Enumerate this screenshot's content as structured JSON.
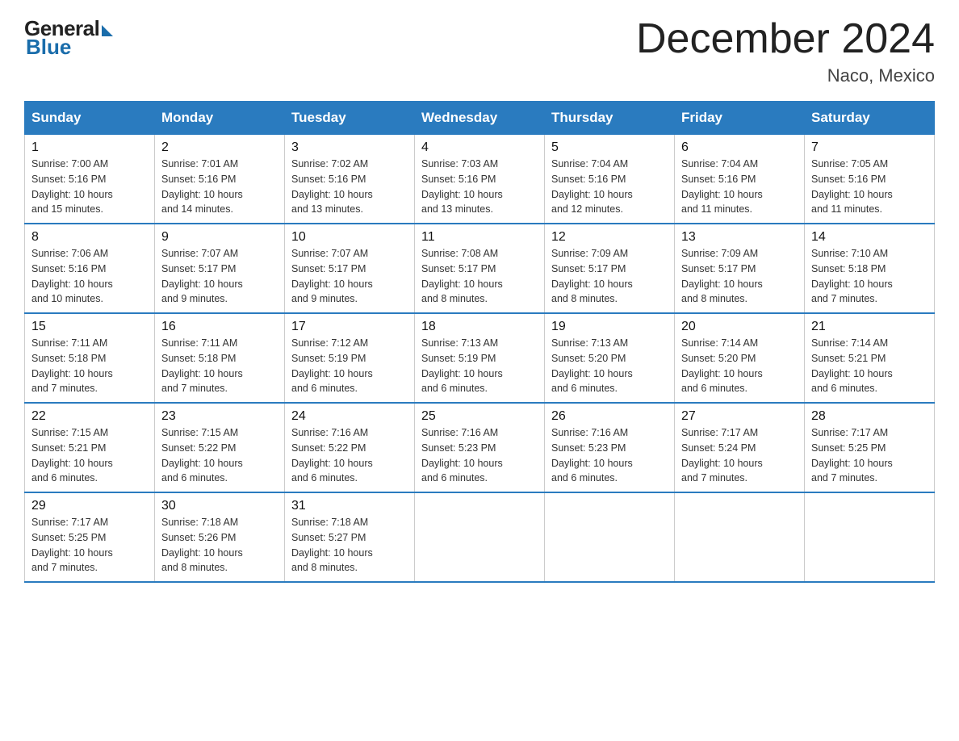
{
  "header": {
    "logo_general": "General",
    "logo_blue": "Blue",
    "month_title": "December 2024",
    "location": "Naco, Mexico"
  },
  "weekdays": [
    "Sunday",
    "Monday",
    "Tuesday",
    "Wednesday",
    "Thursday",
    "Friday",
    "Saturday"
  ],
  "weeks": [
    [
      {
        "day": "1",
        "sunrise": "7:00 AM",
        "sunset": "5:16 PM",
        "daylight": "10 hours and 15 minutes."
      },
      {
        "day": "2",
        "sunrise": "7:01 AM",
        "sunset": "5:16 PM",
        "daylight": "10 hours and 14 minutes."
      },
      {
        "day": "3",
        "sunrise": "7:02 AM",
        "sunset": "5:16 PM",
        "daylight": "10 hours and 13 minutes."
      },
      {
        "day": "4",
        "sunrise": "7:03 AM",
        "sunset": "5:16 PM",
        "daylight": "10 hours and 13 minutes."
      },
      {
        "day": "5",
        "sunrise": "7:04 AM",
        "sunset": "5:16 PM",
        "daylight": "10 hours and 12 minutes."
      },
      {
        "day": "6",
        "sunrise": "7:04 AM",
        "sunset": "5:16 PM",
        "daylight": "10 hours and 11 minutes."
      },
      {
        "day": "7",
        "sunrise": "7:05 AM",
        "sunset": "5:16 PM",
        "daylight": "10 hours and 11 minutes."
      }
    ],
    [
      {
        "day": "8",
        "sunrise": "7:06 AM",
        "sunset": "5:16 PM",
        "daylight": "10 hours and 10 minutes."
      },
      {
        "day": "9",
        "sunrise": "7:07 AM",
        "sunset": "5:17 PM",
        "daylight": "10 hours and 9 minutes."
      },
      {
        "day": "10",
        "sunrise": "7:07 AM",
        "sunset": "5:17 PM",
        "daylight": "10 hours and 9 minutes."
      },
      {
        "day": "11",
        "sunrise": "7:08 AM",
        "sunset": "5:17 PM",
        "daylight": "10 hours and 8 minutes."
      },
      {
        "day": "12",
        "sunrise": "7:09 AM",
        "sunset": "5:17 PM",
        "daylight": "10 hours and 8 minutes."
      },
      {
        "day": "13",
        "sunrise": "7:09 AM",
        "sunset": "5:17 PM",
        "daylight": "10 hours and 8 minutes."
      },
      {
        "day": "14",
        "sunrise": "7:10 AM",
        "sunset": "5:18 PM",
        "daylight": "10 hours and 7 minutes."
      }
    ],
    [
      {
        "day": "15",
        "sunrise": "7:11 AM",
        "sunset": "5:18 PM",
        "daylight": "10 hours and 7 minutes."
      },
      {
        "day": "16",
        "sunrise": "7:11 AM",
        "sunset": "5:18 PM",
        "daylight": "10 hours and 7 minutes."
      },
      {
        "day": "17",
        "sunrise": "7:12 AM",
        "sunset": "5:19 PM",
        "daylight": "10 hours and 6 minutes."
      },
      {
        "day": "18",
        "sunrise": "7:13 AM",
        "sunset": "5:19 PM",
        "daylight": "10 hours and 6 minutes."
      },
      {
        "day": "19",
        "sunrise": "7:13 AM",
        "sunset": "5:20 PM",
        "daylight": "10 hours and 6 minutes."
      },
      {
        "day": "20",
        "sunrise": "7:14 AM",
        "sunset": "5:20 PM",
        "daylight": "10 hours and 6 minutes."
      },
      {
        "day": "21",
        "sunrise": "7:14 AM",
        "sunset": "5:21 PM",
        "daylight": "10 hours and 6 minutes."
      }
    ],
    [
      {
        "day": "22",
        "sunrise": "7:15 AM",
        "sunset": "5:21 PM",
        "daylight": "10 hours and 6 minutes."
      },
      {
        "day": "23",
        "sunrise": "7:15 AM",
        "sunset": "5:22 PM",
        "daylight": "10 hours and 6 minutes."
      },
      {
        "day": "24",
        "sunrise": "7:16 AM",
        "sunset": "5:22 PM",
        "daylight": "10 hours and 6 minutes."
      },
      {
        "day": "25",
        "sunrise": "7:16 AM",
        "sunset": "5:23 PM",
        "daylight": "10 hours and 6 minutes."
      },
      {
        "day": "26",
        "sunrise": "7:16 AM",
        "sunset": "5:23 PM",
        "daylight": "10 hours and 6 minutes."
      },
      {
        "day": "27",
        "sunrise": "7:17 AM",
        "sunset": "5:24 PM",
        "daylight": "10 hours and 7 minutes."
      },
      {
        "day": "28",
        "sunrise": "7:17 AM",
        "sunset": "5:25 PM",
        "daylight": "10 hours and 7 minutes."
      }
    ],
    [
      {
        "day": "29",
        "sunrise": "7:17 AM",
        "sunset": "5:25 PM",
        "daylight": "10 hours and 7 minutes."
      },
      {
        "day": "30",
        "sunrise": "7:18 AM",
        "sunset": "5:26 PM",
        "daylight": "10 hours and 8 minutes."
      },
      {
        "day": "31",
        "sunrise": "7:18 AM",
        "sunset": "5:27 PM",
        "daylight": "10 hours and 8 minutes."
      },
      null,
      null,
      null,
      null
    ]
  ],
  "labels": {
    "sunrise": "Sunrise:",
    "sunset": "Sunset:",
    "daylight": "Daylight:"
  }
}
